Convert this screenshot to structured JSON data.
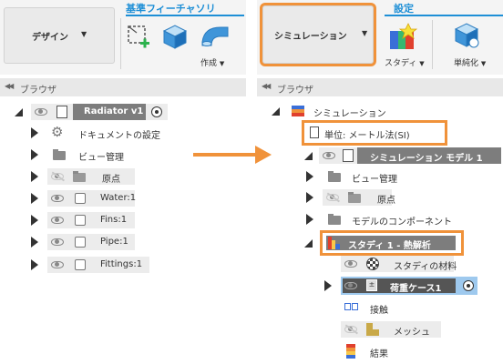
{
  "left": {
    "design_label": "デザイン",
    "section_title": "基準フィーチャソリ",
    "create_label": "作成",
    "browser_title": "ブラウザ",
    "tree": {
      "root": "Radiator v1",
      "items": [
        "ドキュメントの設定",
        "ビュー管理",
        "原点",
        "Water:1",
        "Fins:1",
        "Pipe:1",
        "Fittings:1"
      ]
    }
  },
  "right": {
    "simulation_label": "シミュレーション",
    "section_title": "設定",
    "study_label": "スタディ",
    "simplify_label": "単純化",
    "browser_title": "ブラウザ",
    "tree": {
      "root": "シミュレーション",
      "units": "単位: メートル法(SI)",
      "model": "シミュレーション モデル 1",
      "model_items": [
        "ビュー管理",
        "原点",
        "モデルのコンポーネント"
      ],
      "study": "スタディ 1 - 熱解析",
      "study_items": [
        "スタディの材料",
        "荷重ケース1",
        "接触",
        "メッシュ",
        "結果"
      ]
    }
  },
  "colors": {
    "accent_blue": "#1e8fd6",
    "highlight_orange": "#f0923a",
    "selected_blue": "#9ec9ee"
  }
}
